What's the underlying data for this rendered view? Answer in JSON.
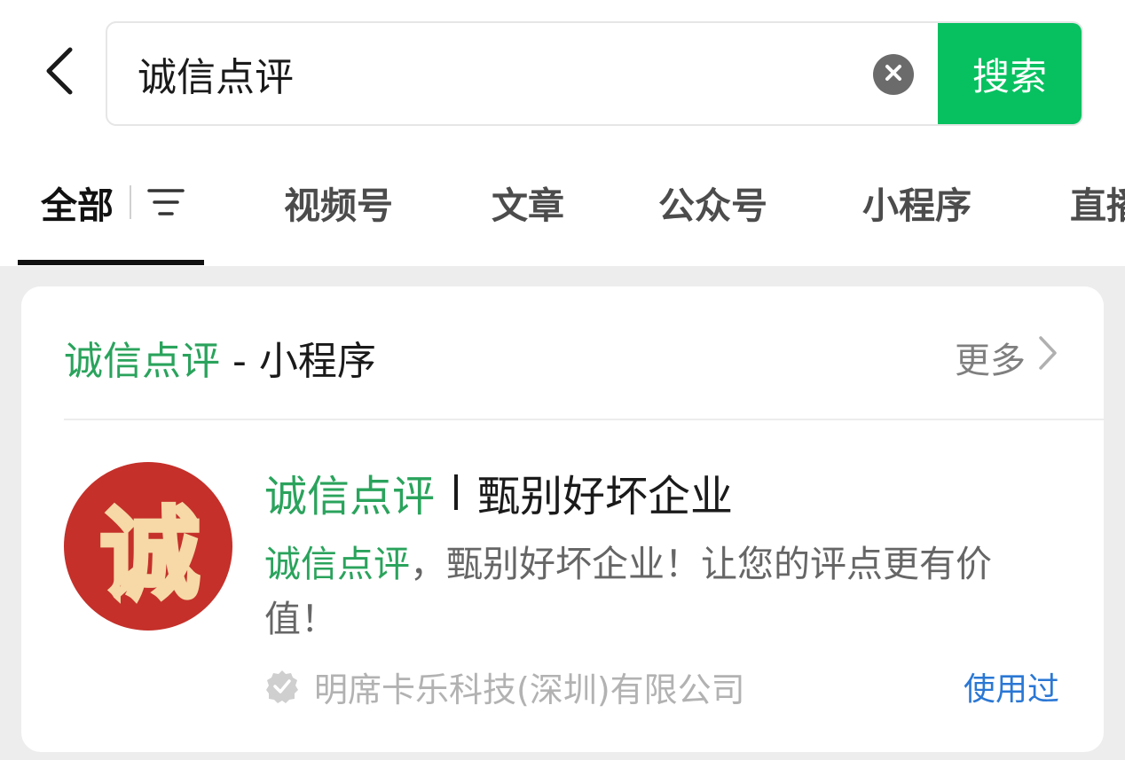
{
  "search": {
    "query": "诚信点评",
    "button_label": "搜索"
  },
  "tabs": {
    "all": "全部",
    "video": "视频号",
    "article": "文章",
    "official_account": "公众号",
    "mini_program": "小程序",
    "live": "直播"
  },
  "section": {
    "keyword": "诚信点评",
    "suffix": " - 小程序",
    "more_label": "更多"
  },
  "result": {
    "logo_char": "诚",
    "title_keyword": "诚信点评",
    "title_rest": "甄别好坏企业",
    "desc_keyword": "诚信点评",
    "desc_rest": "，甄别好坏企业！让您的评点更有价值！",
    "company": "明席卡乐科技(深圳)有限公司",
    "used_label": "使用过"
  },
  "colors": {
    "accent_green": "#07c160",
    "highlight_green": "#2aa35c",
    "logo_red": "#c5302a",
    "link_blue": "#2a77d4"
  },
  "icons": {
    "back": "chevron-left-icon",
    "clear": "clear-circle-icon",
    "filter": "filter-lines-icon",
    "more": "chevron-right-icon",
    "verified": "verified-badge-icon"
  }
}
